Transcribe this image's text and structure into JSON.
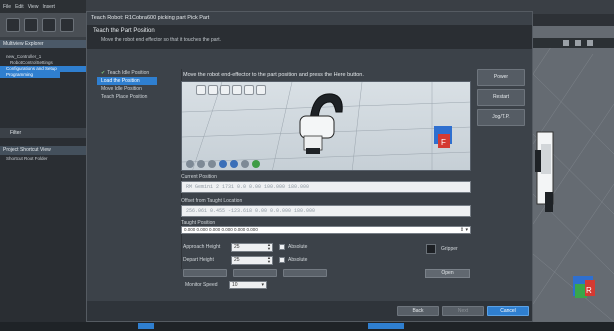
{
  "app": {
    "menu": [
      "File",
      "Edit",
      "View",
      "Insert"
    ],
    "left_panel_title": "Multiview Explorer",
    "tree_items": [
      "new_Controller_1",
      "RobotControlSettings",
      "Configurations and Setup",
      "Programming"
    ],
    "filter_label": "Filter",
    "shortcut_panel_title": "Project Shortcut View",
    "shortcut_item": "Shortcut Root Folder"
  },
  "dialog": {
    "title": "Teach Robot: R1Cobra600 picking part Pick Part",
    "header_title": "Teach the Part Position",
    "header_subtitle": "Move the robot end effector so that it touches the part.",
    "steps": [
      {
        "label": "Teach Idle Position",
        "state": "done"
      },
      {
        "label": "Load the Position",
        "state": "active"
      },
      {
        "label": "Move Idle Position",
        "state": "pending"
      },
      {
        "label": "Teach Place Position",
        "state": "pending"
      }
    ],
    "instruction": "Move the robot end-effector to the part position and press the Here button.",
    "current_position_label": "Current Position",
    "current_position_value": "RM Gemini 2 1731 0.0 0.00 100.000 180.000",
    "offset_label": "Offset from Taught Location",
    "offset_value": "256.061  0.455  -123.618 0.00 0.0.000  180.000",
    "taught_position_label": "Taught Position",
    "taught_position_value": "0.000 0.000 0.000 0.000 0.000 0.000",
    "approach_label": "Approach Height",
    "approach_value": "25",
    "depart_label": "Depart Height",
    "depart_value": "25",
    "absolute_label": "Absolute",
    "gripper_label": "Gripper",
    "open_button": "Open",
    "monitor_speed_label": "Monitor Speed",
    "monitor_speed_value": "10",
    "side_buttons": [
      "Power",
      "Restart",
      "Jog/T.P."
    ],
    "footer_buttons": {
      "back": "Back",
      "next": "Next",
      "cancel": "Cancel"
    }
  }
}
